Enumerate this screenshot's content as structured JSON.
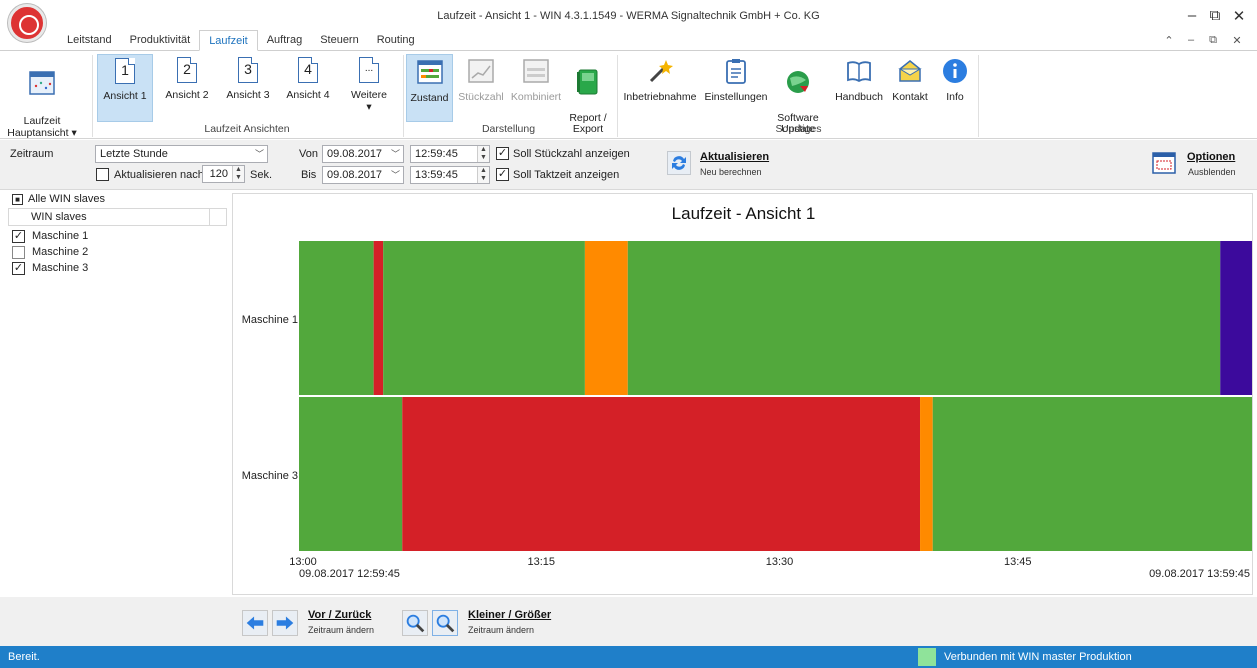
{
  "window": {
    "title": "Laufzeit - Ansicht 1 - WIN 4.3.1.1549 - WERMA Signaltechnik GmbH + Co. KG"
  },
  "tabs": [
    "Leitstand",
    "Produktivität",
    "Laufzeit",
    "Auftrag",
    "Steuern",
    "Routing"
  ],
  "active_tab": "Laufzeit",
  "ribbon": {
    "hauptansicht": "Laufzeit\nHauptansicht ▾",
    "ansichten": [
      {
        "label": "Ansicht 1",
        "num": "1"
      },
      {
        "label": "Ansicht 2",
        "num": "2"
      },
      {
        "label": "Ansicht 3",
        "num": "3"
      },
      {
        "label": "Ansicht 4",
        "num": "4"
      }
    ],
    "weitere": "Weitere",
    "weitere_dots": "...",
    "weitere_arrow": "▾",
    "group_ansichten": "Laufzeit Ansichten",
    "darstellung": [
      "Zustand",
      "Stückzahl",
      "Kombiniert"
    ],
    "report": "Report /\nExport",
    "group_darstellung": "Darstellung",
    "sonstiges": [
      "Inbetriebnahme",
      "Einstellungen",
      "Software\nUpdate",
      "Handbuch",
      "Kontakt",
      "Info"
    ],
    "group_sonstiges": "Sonstiges"
  },
  "filter": {
    "zeitraum_label": "Zeitraum",
    "zeitraum_value": "Letzte Stunde",
    "aktualisieren_nach": "Aktualisieren nach",
    "interval": "120",
    "sek": "Sek.",
    "von_label": "Von",
    "bis_label": "Bis",
    "von_date": "09.08.2017",
    "von_time": "12:59:45",
    "bis_date": "09.08.2017",
    "bis_time": "13:59:45",
    "soll_stueck": "Soll Stückzahl anzeigen",
    "soll_takt": "Soll Taktzeit anzeigen",
    "aktualisieren_title": "Aktualisieren",
    "aktualisieren_sub": "Neu berechnen",
    "optionen_title": "Optionen",
    "optionen_sub": "Ausblenden"
  },
  "slaves": {
    "all_label": "Alle WIN slaves",
    "column": "WIN slaves",
    "items": [
      {
        "name": "Maschine 1",
        "checked": true
      },
      {
        "name": "Maschine 2",
        "checked": false
      },
      {
        "name": "Maschine 3",
        "checked": true
      }
    ]
  },
  "chart_data": {
    "type": "timeline",
    "title": "Laufzeit - Ansicht 1",
    "x_range": [
      "12:59:45",
      "13:59:45"
    ],
    "ticks": [
      "13:00",
      "13:15",
      "13:30",
      "13:45"
    ],
    "start_label": "09.08.2017 12:59:45",
    "end_label": "09.08.2017 13:59:45",
    "colors": {
      "green": "#52a83c",
      "red": "#d42027",
      "orange": "#ff8a00",
      "purple": "#3c0a9c"
    },
    "rows": [
      {
        "name": "Maschine 1",
        "segments": [
          {
            "start": 0,
            "end": 4.7,
            "state": "green"
          },
          {
            "start": 4.7,
            "end": 5.3,
            "state": "red"
          },
          {
            "start": 5.3,
            "end": 18.0,
            "state": "green"
          },
          {
            "start": 18.0,
            "end": 20.7,
            "state": "orange"
          },
          {
            "start": 20.7,
            "end": 58.0,
            "state": "green"
          },
          {
            "start": 58.0,
            "end": 60.0,
            "state": "purple"
          }
        ]
      },
      {
        "name": "Maschine 3",
        "segments": [
          {
            "start": 0,
            "end": 6.5,
            "state": "green"
          },
          {
            "start": 6.5,
            "end": 39.1,
            "state": "red"
          },
          {
            "start": 39.1,
            "end": 39.9,
            "state": "orange"
          },
          {
            "start": 39.9,
            "end": 60.0,
            "state": "green"
          }
        ]
      }
    ]
  },
  "bottomnav": {
    "vor_title": "Vor / Zurück",
    "vor_sub": "Zeitraum ändern",
    "zoom_title": "Kleiner / Größer",
    "zoom_sub": "Zeitraum ändern"
  },
  "status": {
    "left": "Bereit.",
    "right": "Verbunden mit WIN master Produktion",
    "indicator_color": "#8fe39a"
  }
}
